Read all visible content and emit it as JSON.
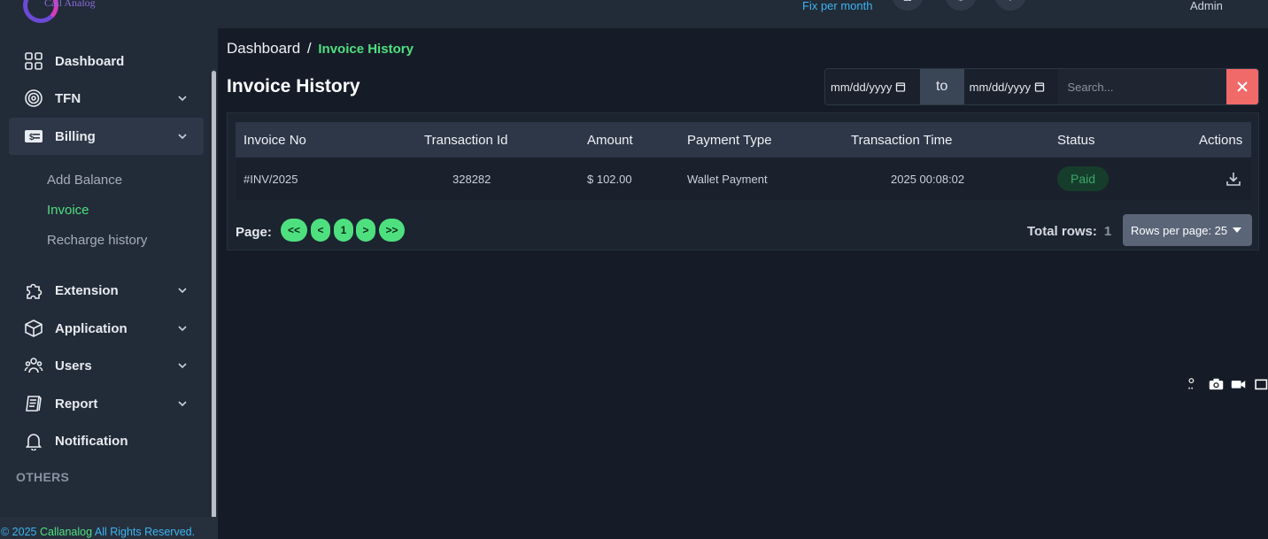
{
  "topbar": {
    "logo_text": "Call Analog",
    "plan_text": "Fix per month",
    "user": "Admin"
  },
  "breadcrumb": {
    "root": "Dashboard",
    "separator": "/",
    "current": "Invoice History"
  },
  "page_title": "Invoice History",
  "sidebar": {
    "items": [
      {
        "label": "Dashboard",
        "icon": "grid-icon"
      },
      {
        "label": "TFN",
        "icon": "target-icon"
      },
      {
        "label": "Billing",
        "icon": "dollar-bill-icon"
      },
      {
        "label": "Extension",
        "icon": "puzzle-icon"
      },
      {
        "label": "Application",
        "icon": "cube-icon"
      },
      {
        "label": "Users",
        "icon": "users-icon"
      },
      {
        "label": "Report",
        "icon": "report-icon"
      },
      {
        "label": "Notification",
        "icon": "bell-icon"
      }
    ],
    "billing_sub": [
      "Add Balance",
      "Invoice",
      "Recharge history"
    ],
    "section_others": "OTHERS"
  },
  "filters": {
    "from_placeholder": "mm/dd/yyyy",
    "to_label": "to",
    "to_placeholder": "mm/dd/yyyy",
    "search_placeholder": "Search..."
  },
  "table": {
    "columns": [
      "Invoice No",
      "Transaction Id",
      "Amount",
      "Payment Type",
      "Transaction Time",
      "Status",
      "Actions"
    ],
    "rows": [
      {
        "invoice_no": "#INV/2025",
        "transaction_id": "328282",
        "amount": "$ 102.00",
        "payment_type": "Wallet Payment",
        "time": "2025 00:08:02",
        "status": "Paid"
      }
    ]
  },
  "pager": {
    "label": "Page:",
    "first": "<<",
    "prev": "<",
    "page": "1",
    "next": ">",
    "last": ">>",
    "total_label": "Total rows:",
    "total_value": "1",
    "rows_per_page": "Rows per page: 25"
  },
  "footer": {
    "prefix": "© 2025",
    "brand": "Callanalog",
    "suffix": "All Rights Reserved."
  },
  "colors": {
    "accent": "#4ee07f",
    "link": "#3cb4f0",
    "danger": "#f06a6a",
    "bg": "#161c27",
    "panel": "#222b38"
  }
}
